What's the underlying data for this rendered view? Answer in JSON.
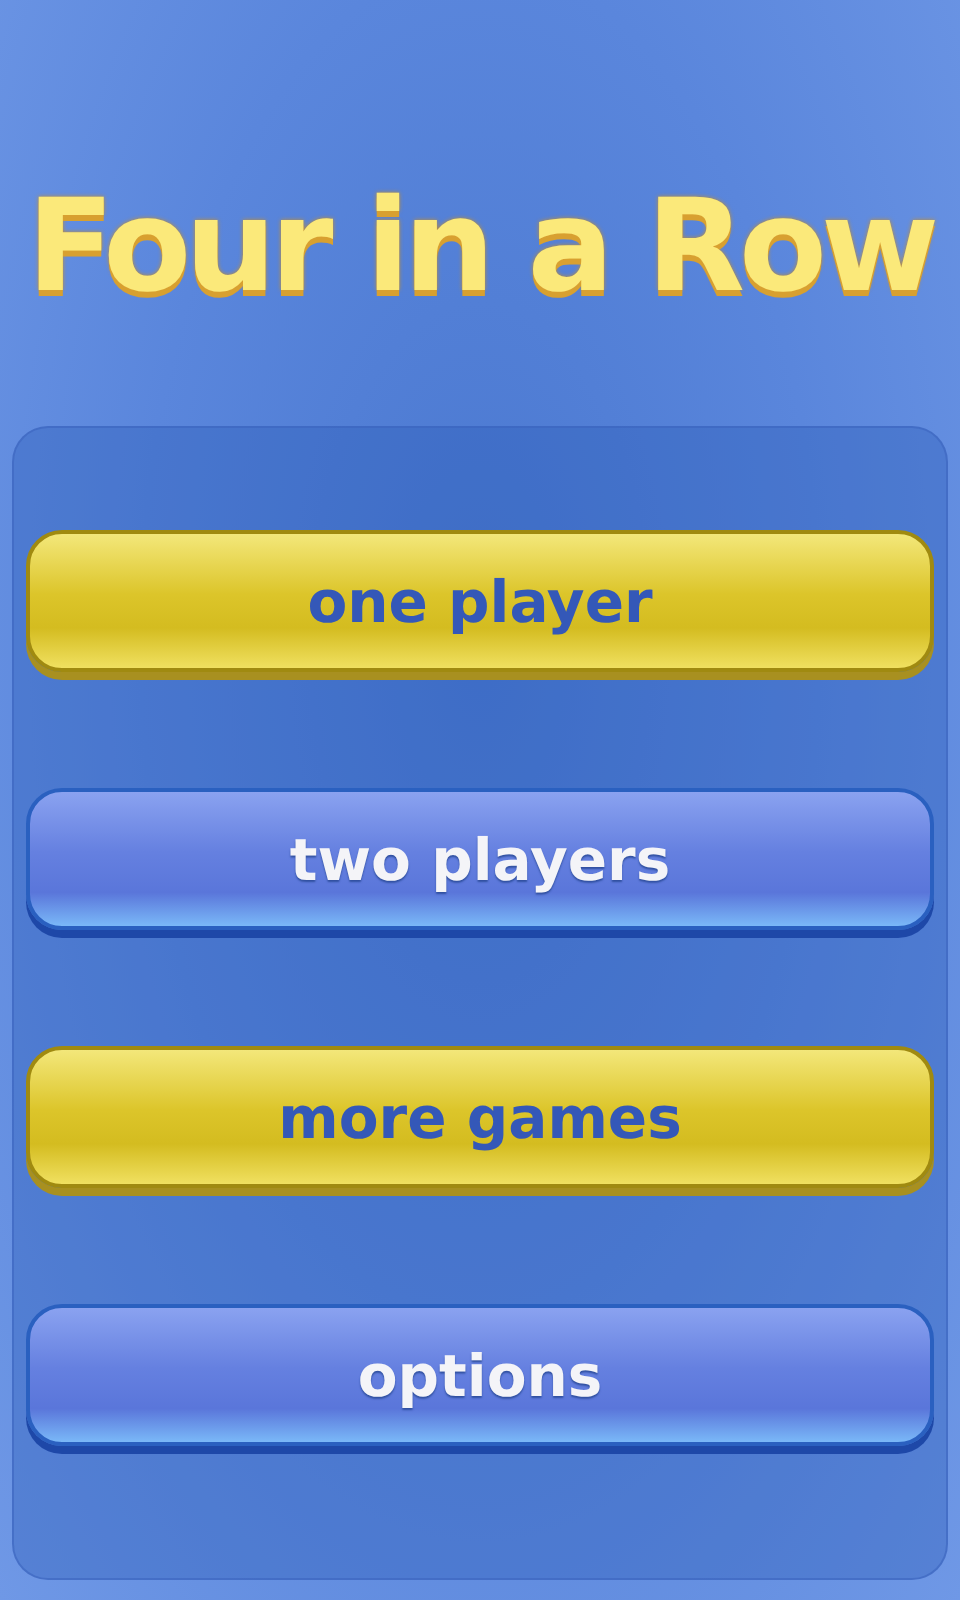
{
  "title": "Four in a Row",
  "menu": [
    {
      "label": "one player",
      "kind": "gold"
    },
    {
      "label": "two players",
      "kind": "blue"
    },
    {
      "label": "more games",
      "kind": "gold"
    },
    {
      "label": "options",
      "kind": "blue"
    }
  ]
}
